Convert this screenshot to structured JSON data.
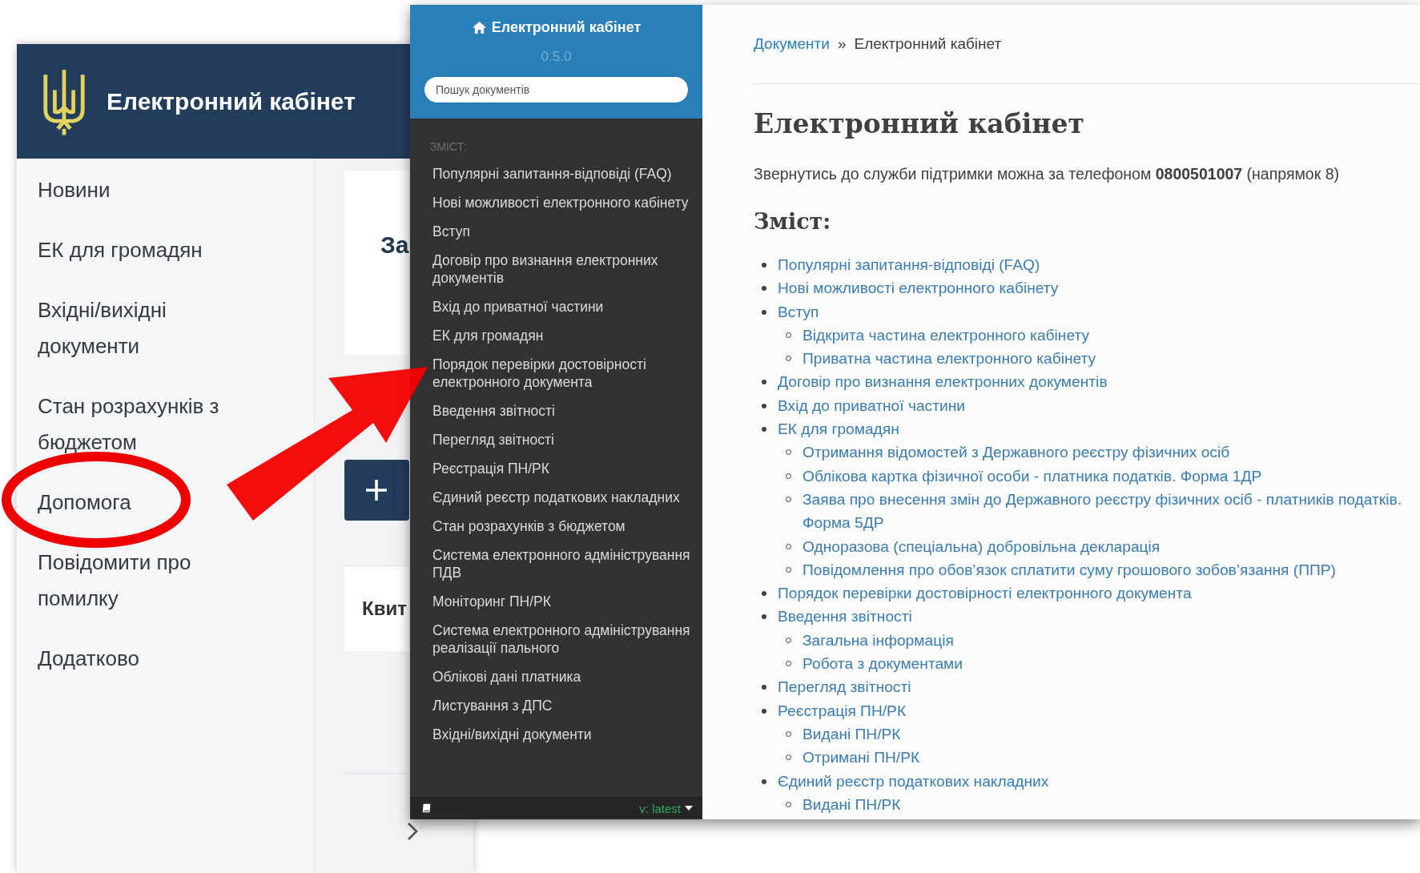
{
  "back_window": {
    "app_title": "Електронний кабінет",
    "sidebar": {
      "items": [
        {
          "label": "Новини"
        },
        {
          "label": "ЕК для громадян"
        },
        {
          "label": "Вхідні/вихідні документи"
        },
        {
          "label": "Стан розрахунків з бюджетом"
        },
        {
          "label": "Допомога"
        },
        {
          "label": "Повідомити про помилку"
        },
        {
          "label": "Додатково"
        }
      ]
    },
    "content": {
      "card_title": "За",
      "row_label": "Квит"
    }
  },
  "front_window": {
    "sidebar": {
      "title": "Електронний кабінет",
      "version": "0.5.0",
      "search": {
        "placeholder": "Пошук документів"
      },
      "caption": "ЗМІСТ:",
      "items": [
        {
          "label": "Популярні запитання-відповіді (FAQ)"
        },
        {
          "label": "Нові можливості електронного кабінету"
        },
        {
          "label": "Вступ"
        },
        {
          "label": "Договір про визнання електронних документів"
        },
        {
          "label": "Вхід до приватної частини"
        },
        {
          "label": "ЕК для громадян"
        },
        {
          "label": "Порядок перевірки достовірності електронного документа"
        },
        {
          "label": "Введення звітності"
        },
        {
          "label": "Перегляд звітності"
        },
        {
          "label": "Реєстрація ПН/РК"
        },
        {
          "label": "Єдиний реєстр податкових накладних"
        },
        {
          "label": "Стан розрахунків з бюджетом"
        },
        {
          "label": "Система електронного адміністрування ПДВ"
        },
        {
          "label": "Моніторинг ПН/РК"
        },
        {
          "label": "Система електронного адміністрування реалізації пального"
        },
        {
          "label": "Облікові дані платника"
        },
        {
          "label": "Листування з ДПС"
        },
        {
          "label": "Вхідні/вихідні документи"
        }
      ],
      "footer": {
        "version_label": "v: latest"
      }
    },
    "breadcrumb": {
      "link": "Документи",
      "separator": "»",
      "current": "Електронний кабінет"
    },
    "heading": "Електронний кабінет",
    "intro": "Звернутись до служби підтримки можна за телефоном **0800501007** (напрямок 8)",
    "toc_heading": "Зміст:",
    "toc": [
      {
        "label": "Популярні запитання-відповіді (FAQ)"
      },
      {
        "label": "Нові можливості електронного кабінету"
      },
      {
        "label": "Вступ",
        "children": [
          {
            "label": "Відкрита частина електронного кабінету"
          },
          {
            "label": "Приватна частина електронного кабінету"
          }
        ]
      },
      {
        "label": "Договір про визнання електронних документів"
      },
      {
        "label": "Вхід до приватної частини"
      },
      {
        "label": "ЕК для громадян",
        "children": [
          {
            "label": "Отримання відомостей з Державного реєстру фізичних осіб"
          },
          {
            "label": "Облікова картка фізичної особи - платника податків. Форма 1ДР"
          },
          {
            "label": "Заява про внесення змін до Державного реєстру фізичних осіб - платників податків. Форма 5ДР"
          },
          {
            "label": "Одноразова (спеціальна) добровільна декларація"
          },
          {
            "label": "Повідомлення про обов’язок сплатити суму грошового зобов’язання (ППР)"
          }
        ]
      },
      {
        "label": "Порядок перевірки достовірності електронного документа"
      },
      {
        "label": "Введення звітності",
        "children": [
          {
            "label": "Загальна інформація"
          },
          {
            "label": "Робота з документами"
          }
        ]
      },
      {
        "label": "Перегляд звітності"
      },
      {
        "label": "Реєстрація ПН/РК",
        "children": [
          {
            "label": "Видані ПН/РК"
          },
          {
            "label": "Отримані ПН/РК"
          }
        ]
      },
      {
        "label": "Єдиний реєстр податкових накладних",
        "children": [
          {
            "label": "Видані ПН/РК"
          }
        ]
      }
    ]
  }
}
